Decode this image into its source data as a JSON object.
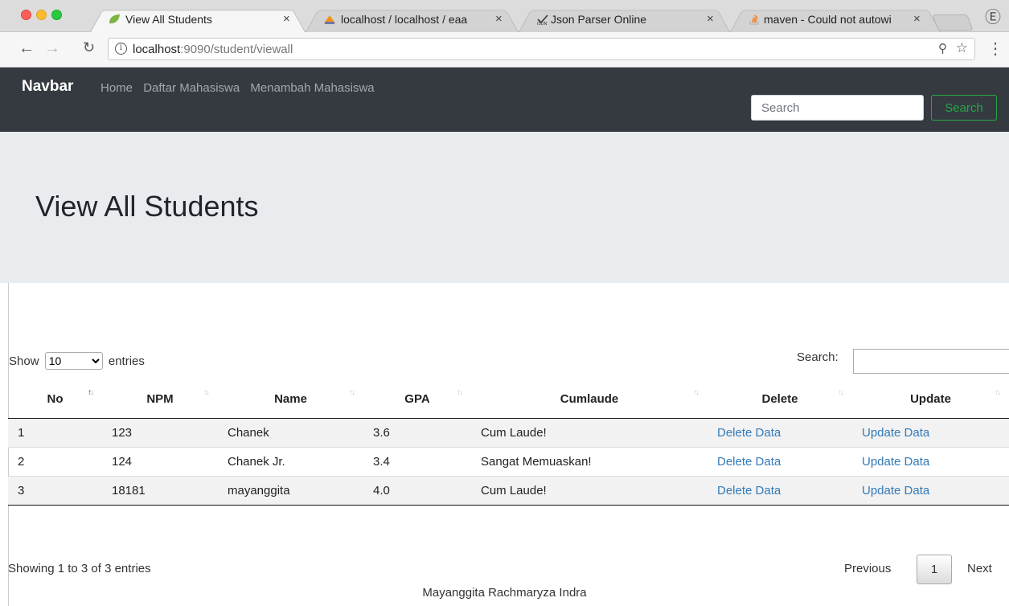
{
  "browser": {
    "tabs": [
      {
        "title": "View All Students",
        "icon": "spring-leaf-icon",
        "active": true
      },
      {
        "title": "localhost / localhost / eaa",
        "icon": "phpmyadmin-icon",
        "active": false
      },
      {
        "title": "Json Parser Online",
        "icon": "json-icon",
        "active": false
      },
      {
        "title": "maven - Could not autowi",
        "icon": "stackoverflow-icon",
        "active": false
      }
    ],
    "close_glyph": "×",
    "url_host": "localhost",
    "url_rest": ":9090/student/viewall"
  },
  "navbar": {
    "brand": "Navbar",
    "links": [
      "Home",
      "Daftar Mahasiswa",
      "Menambah Mahasiswa"
    ],
    "search_placeholder": "Search",
    "search_button": "Search"
  },
  "jumbotron": {
    "title": "View All Students"
  },
  "table_controls": {
    "show_label": "Show",
    "page_length": "10",
    "entries_label": "entries",
    "search_label": "Search:"
  },
  "table": {
    "headers": [
      "No",
      "NPM",
      "Name",
      "GPA",
      "Cumlaude",
      "Delete",
      "Update"
    ],
    "rows": [
      [
        "1",
        "123",
        "Chanek",
        "3.6",
        "Cum Laude!",
        "Delete Data",
        "Update Data"
      ],
      [
        "2",
        "124",
        "Chanek Jr.",
        "3.4",
        "Sangat Memuaskan!",
        "Delete Data",
        "Update Data"
      ],
      [
        "3",
        "18181",
        "mayanggita",
        "4.0",
        "Cum Laude!",
        "Delete Data",
        "Update Data"
      ]
    ]
  },
  "pagination": {
    "info": "Showing 1 to 3 of 3 entries",
    "previous": "Previous",
    "current_page": "1",
    "next": "Next"
  },
  "footer": {
    "text": "Mayanggita Rachmaryza Indra"
  },
  "colors": {
    "navbar_bg": "#343a40",
    "jumbotron_bg": "#e9ecef",
    "link": "#337ab7",
    "search_btn": "#28a745"
  }
}
